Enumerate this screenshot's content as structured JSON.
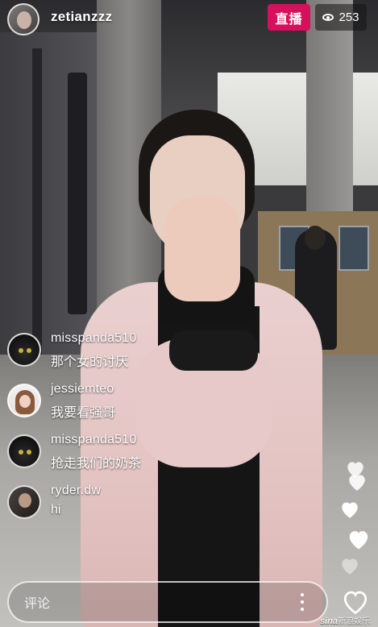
{
  "header": {
    "username": "zetianzzz",
    "live_label": "直播",
    "viewer_count": "253",
    "viewer_icon": "eye-icon",
    "live_badge_color": "#d6105c"
  },
  "comments": [
    {
      "user": "misspanda510",
      "text": "那个女的讨厌",
      "avatar": "black-cat"
    },
    {
      "user": "jessiemteo",
      "text": "我要看强哥",
      "avatar": "girl-portrait"
    },
    {
      "user": "misspanda510",
      "text": "抢走我们的奶茶",
      "avatar": "black-cat"
    },
    {
      "user": "ryder.dw",
      "text": "hi",
      "avatar": "man-portrait"
    }
  ],
  "footer": {
    "comment_placeholder": "评论",
    "more_icon": "more-vertical-icon",
    "like_icon": "heart-outline-icon",
    "floating_hearts": 5
  },
  "watermark": {
    "logo": "sina",
    "text": "新浪娱乐"
  }
}
